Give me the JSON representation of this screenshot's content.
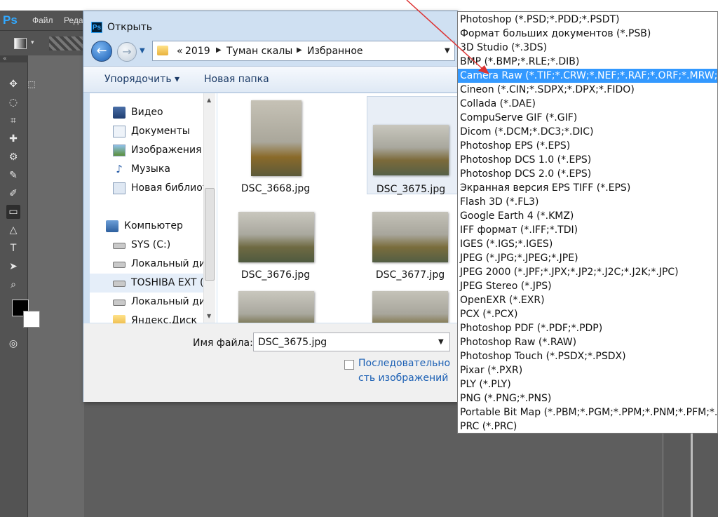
{
  "app": {
    "logo": "Ps",
    "menus": [
      "Файл",
      "Реда"
    ]
  },
  "dialog": {
    "title": "Открыть",
    "breadcrumb": [
      "«",
      "2019",
      "Туман скалы",
      "Избранное"
    ],
    "organize_label": "Упорядочить ▾",
    "new_folder_label": "Новая папка",
    "nav_items": [
      {
        "label": "Видео",
        "icon": "video-icon"
      },
      {
        "label": "Документы",
        "icon": "documents-icon"
      },
      {
        "label": "Изображения",
        "icon": "pictures-icon"
      },
      {
        "label": "Музыка",
        "icon": "music-icon"
      },
      {
        "label": "Новая библиот",
        "icon": "library-icon"
      },
      {
        "label": "Компьютер",
        "icon": "computer-icon"
      },
      {
        "label": "SYS (C:)",
        "icon": "drive-icon"
      },
      {
        "label": "Локальный дис",
        "icon": "drive-icon"
      },
      {
        "label": "TOSHIBA EXT (",
        "icon": "drive-icon"
      },
      {
        "label": "Локальный дис",
        "icon": "drive-icon"
      },
      {
        "label": "Яндекс.Диск",
        "icon": "folder-icon"
      }
    ],
    "files": [
      {
        "name": "DSC_3668.jpg"
      },
      {
        "name": "DSC_3675.jpg"
      },
      {
        "name": "DSC_3676.jpg"
      },
      {
        "name": "DSC_3677.jpg"
      },
      {
        "name": ""
      },
      {
        "name": ""
      }
    ],
    "filename_label": "Имя файла:",
    "filename_value": "DSC_3675.jpg",
    "sequence_label_1": "Последовательно",
    "sequence_label_2": "сть изображений"
  },
  "formats": [
    "Photoshop (*.PSD;*.PDD;*.PSDT)",
    "Формат больших документов (*.PSB)",
    "3D Studio (*.3DS)",
    "BMP (*.BMP;*.RLE;*.DIB)",
    "Camera Raw (*.TIF;*.CRW;*.NEF;*.RAF;*.ORF;*.MRW;*.DCR",
    "Cineon (*.CIN;*.SDPX;*.DPX;*.FIDO)",
    "Collada (*.DAE)",
    "CompuServe GIF (*.GIF)",
    "Dicom (*.DCM;*.DC3;*.DIC)",
    "Photoshop EPS (*.EPS)",
    "Photoshop DCS 1.0 (*.EPS)",
    "Photoshop DCS 2.0 (*.EPS)",
    "Экранная версия EPS TIFF (*.EPS)",
    "Flash 3D (*.FL3)",
    "Google Earth 4 (*.KMZ)",
    "IFF формат (*.IFF;*.TDI)",
    "IGES (*.IGS;*.IGES)",
    "JPEG (*.JPG;*.JPEG;*.JPE)",
    "JPEG 2000 (*.JPF;*.JPX;*.JP2;*.J2C;*.J2K;*.JPC)",
    "JPEG Stereo (*.JPS)",
    "OpenEXR (*.EXR)",
    "PCX (*.PCX)",
    "Photoshop PDF (*.PDF;*.PDP)",
    "Photoshop Raw (*.RAW)",
    "Photoshop Touch (*.PSDX;*.PSDX)",
    "Pixar (*.PXR)",
    "PLY (*.PLY)",
    "PNG (*.PNG;*.PNS)",
    "Portable Bit Map (*.PBM;*.PGM;*.PPM;*.PNM;*.PFM;*.PAM",
    "PRC (*.PRC)"
  ],
  "selected_format_index": 4,
  "colors": {
    "accent": "#3399ff",
    "ps_blue": "#31a8ff",
    "ps_panel": "#535353"
  }
}
